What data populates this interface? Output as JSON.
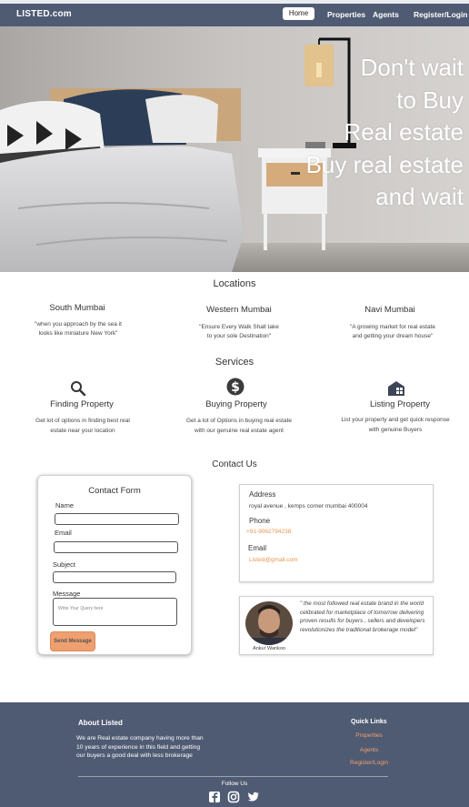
{
  "nav": {
    "brand": "LISTED.com",
    "links": [
      "Home",
      "Properties",
      "Agents",
      "Register/Login"
    ],
    "active": "Home"
  },
  "hero": {
    "lines": [
      "Don't wait",
      "to Buy",
      "Real estate",
      "Buy real estate",
      "and wait"
    ]
  },
  "locations": {
    "title": "Locations",
    "items": [
      {
        "name": "South Mumbai",
        "desc": [
          "\"when you approach by the sea it",
          "looks like miniature New York\""
        ]
      },
      {
        "name": "Western Mumbai",
        "desc": [
          "\"Ensure Every Walk Shall take",
          "to your sole Destination\""
        ]
      },
      {
        "name": "Navi Mumbai",
        "desc": [
          "\"A growing market for real estate",
          "and getting your dream house\""
        ]
      }
    ]
  },
  "services": {
    "title": "Services",
    "items": [
      {
        "name": "Finding Property",
        "icon": "search-icon",
        "desc": [
          "Get lot of options in finding best real",
          "estate near your location"
        ]
      },
      {
        "name": "Buying Property",
        "icon": "dollar-icon",
        "desc": [
          "Get a lot of Options  in buying real estate",
          "with  our genuine real estate agent"
        ]
      },
      {
        "name": "Listing Property",
        "icon": "building-icon",
        "desc": [
          "List your property and get quick response",
          "with genuine Buyers"
        ]
      }
    ]
  },
  "contact": {
    "title": "Contact Us",
    "form": {
      "title": "Contact Form",
      "name_label": "Name",
      "email_label": "Email",
      "subject_label": "Subject",
      "message_label": "Message",
      "message_placeholder": "Write Your Query here",
      "send_label": "Send Message"
    },
    "address": {
      "address_label": "Address",
      "address_value": "royal avenue , kemps corner mumbai 400004",
      "phone_label": "Phone",
      "phone_value": "+91-9062794238",
      "email_label": "Email",
      "email_value": "Listed@gmail.com"
    },
    "testimonial": {
      "name": "Ankur Wankoo",
      "quote": "\" the most followed real estate brand in the world celibrated for marketplace of tomorrow delivering proven results for buyers , sellers and developers revolutionizes the traditional brokerage model\""
    }
  },
  "footer": {
    "about_title": "About Listed",
    "about_text": "We are Real estate company having more than 10 years of experience in this field and getting our buyers a good deal with less brokerage",
    "quick_links_title": "Quick Links",
    "quick_links": [
      "Properties",
      "Agents",
      "Register/Login"
    ],
    "follow_label": "Follow Us",
    "social": [
      "facebook-icon",
      "instagram-icon",
      "twitter-icon"
    ]
  },
  "colors": {
    "navbar": "#4f5b73",
    "accent_orange": "#f0a070"
  }
}
